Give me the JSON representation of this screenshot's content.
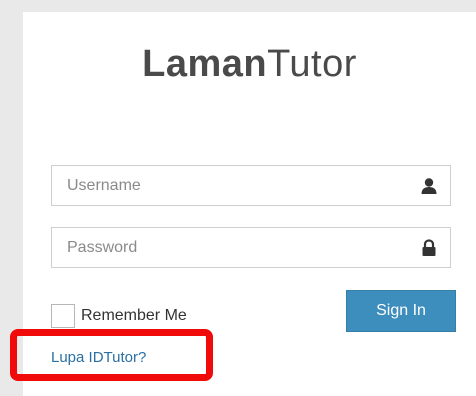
{
  "brand": {
    "bold": "Laman",
    "light": "Tutor"
  },
  "form": {
    "username_placeholder": "Username",
    "password_placeholder": "Password",
    "username_icon": "user-icon",
    "password_icon": "lock-icon",
    "remember_label": "Remember Me",
    "signin_label": "Sign In",
    "forgot_link": "Lupa IDTutor?"
  },
  "colors": {
    "accent": "#3d8dbd",
    "link": "#2a6fa3",
    "highlight": "#f00a0a"
  }
}
